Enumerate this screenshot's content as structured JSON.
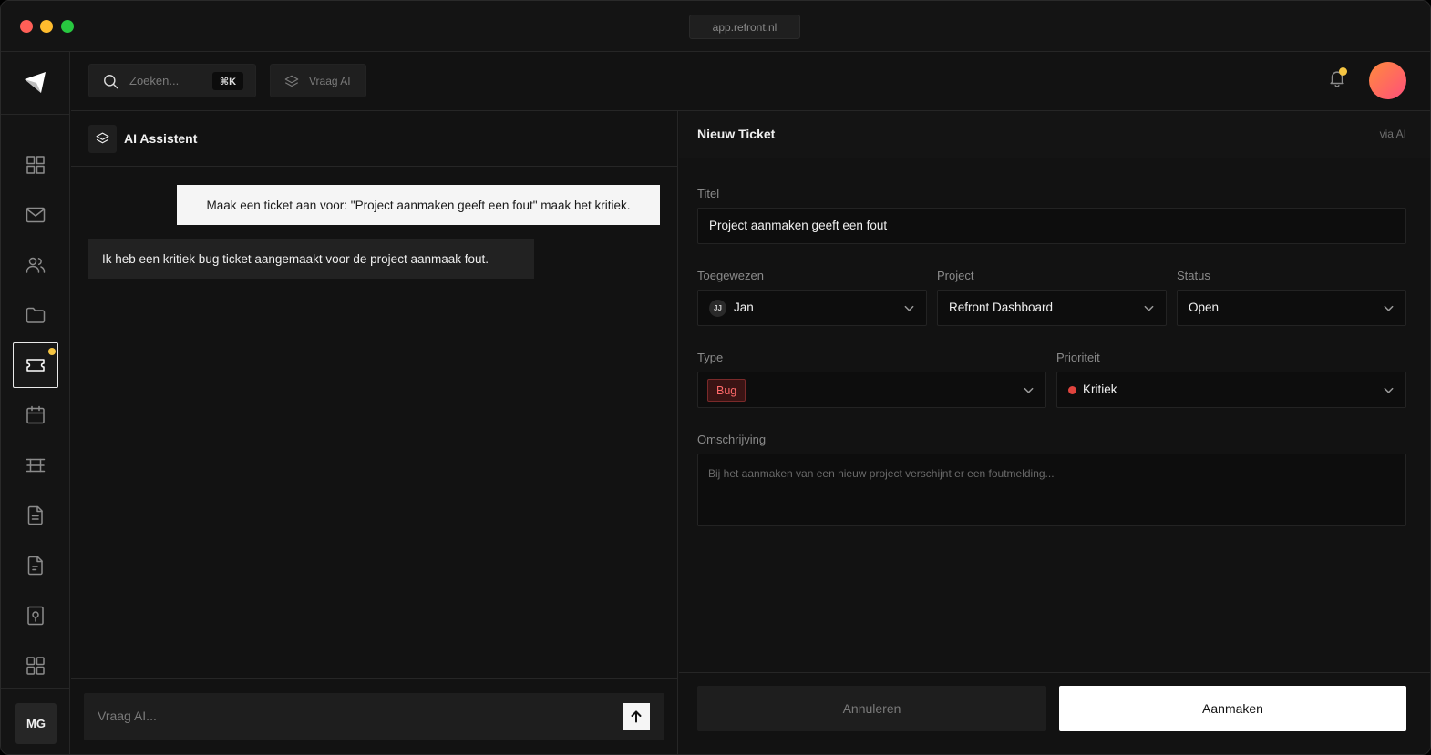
{
  "window": {
    "url": "app.refront.nl"
  },
  "sidebar": {
    "items": [
      {
        "icon": "dashboard-grid-icon",
        "name": "sidebar-item-dashboard"
      },
      {
        "icon": "mail-icon",
        "name": "sidebar-item-mail"
      },
      {
        "icon": "users-icon",
        "name": "sidebar-item-users"
      },
      {
        "icon": "folder-icon",
        "name": "sidebar-item-projects"
      },
      {
        "icon": "ticket-icon",
        "name": "sidebar-item-tickets",
        "active": true,
        "badge": true
      },
      {
        "icon": "calendar-icon",
        "name": "sidebar-item-calendar"
      },
      {
        "icon": "film-icon",
        "name": "sidebar-item-media"
      },
      {
        "icon": "document-icon",
        "name": "sidebar-item-documents"
      },
      {
        "icon": "invoice-icon",
        "name": "sidebar-item-invoices"
      },
      {
        "icon": "safe-icon",
        "name": "sidebar-item-vault"
      },
      {
        "icon": "apps-grid-icon",
        "name": "sidebar-item-apps"
      }
    ],
    "user_initials": "MG"
  },
  "header": {
    "search_placeholder": "Zoeken...",
    "search_shortcut": "⌘K",
    "ask_ai_label": "Vraag AI"
  },
  "ai_panel": {
    "title": "AI Assistent",
    "messages": [
      {
        "role": "user",
        "text": "Maak een ticket aan voor: \"Project aanmaken geeft een fout\" maak het kritiek."
      },
      {
        "role": "assistant",
        "text": "Ik heb een kritiek bug ticket aangemaakt voor de project aanmaak fout."
      }
    ],
    "input_placeholder": "Vraag AI..."
  },
  "ticket": {
    "header_title": "Nieuw Ticket",
    "header_source": "via AI",
    "title_label": "Titel",
    "title_value": "Project aanmaken geeft een fout",
    "assigned_label": "Toegewezen",
    "assigned_initials": "JJ",
    "assigned_value": "Jan",
    "project_label": "Project",
    "project_value": "Refront Dashboard",
    "status_label": "Status",
    "status_value": "Open",
    "type_label": "Type",
    "type_value": "Bug",
    "priority_label": "Prioriteit",
    "priority_value": "Kritiek",
    "description_label": "Omschrijving",
    "description_placeholder": "Bij het aanmaken van een nieuw project verschijnt er een foutmelding...",
    "cancel_label": "Annuleren",
    "create_label": "Aanmaken"
  },
  "colors": {
    "accent_notification": "#f5c542",
    "priority_critical": "#e0443e",
    "bug_tag_text": "#ff6a6a"
  }
}
